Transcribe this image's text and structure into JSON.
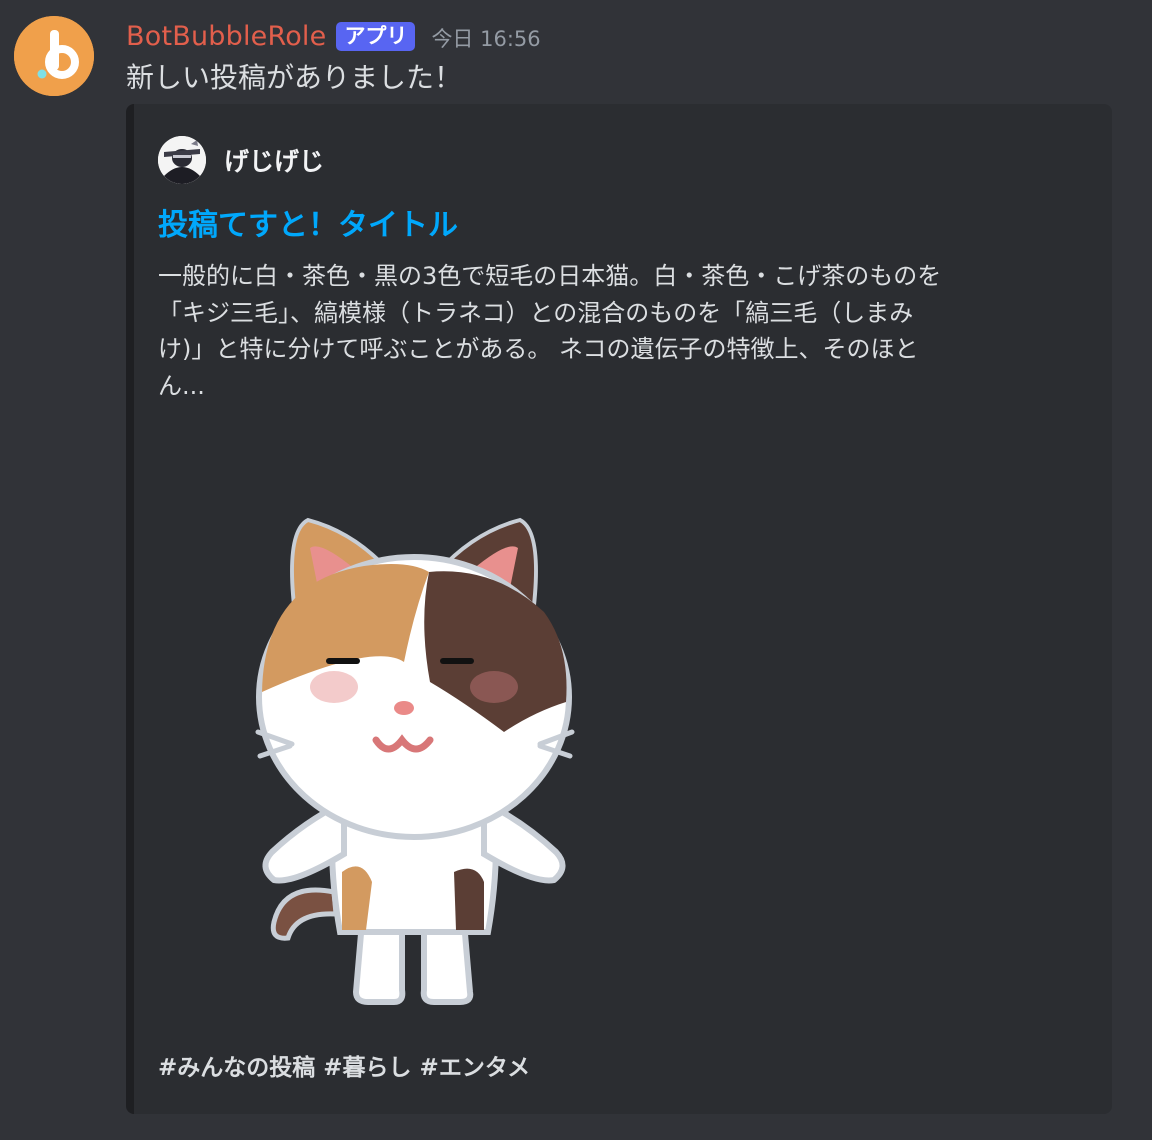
{
  "message": {
    "username": "BotBubbleRole",
    "app_badge": "アプリ",
    "timestamp": "今日 16:56",
    "content": "新しい投稿がありました！",
    "avatar_icon": "bubble-b-logo-icon"
  },
  "embed": {
    "author": {
      "name": "げじげじ",
      "avatar_icon": "user-avatar-icon"
    },
    "title": "投稿てすと！タイトル",
    "description_lines": [
      "一般的に白・茶色・黒の3色で短毛の日本猫。白・茶色・こげ茶のものを",
      "「キジ三毛」、縞模様（トラネコ）との混合のものを「縞三毛（しまみ",
      "け)」と特に分けて呼ぶことがある。 ネコの遺伝子の特徴上、そのほと",
      "ん..."
    ],
    "image_icon": "calico-cat-illustration",
    "tags": "#みんなの投稿 #暮らし #エンタメ"
  },
  "colors": {
    "background": "#313338",
    "embed_background": "#2b2d31",
    "username": "#e25f4c",
    "badge": "#5865f2",
    "link": "#00a8fc",
    "avatar": "#f0a04b"
  }
}
